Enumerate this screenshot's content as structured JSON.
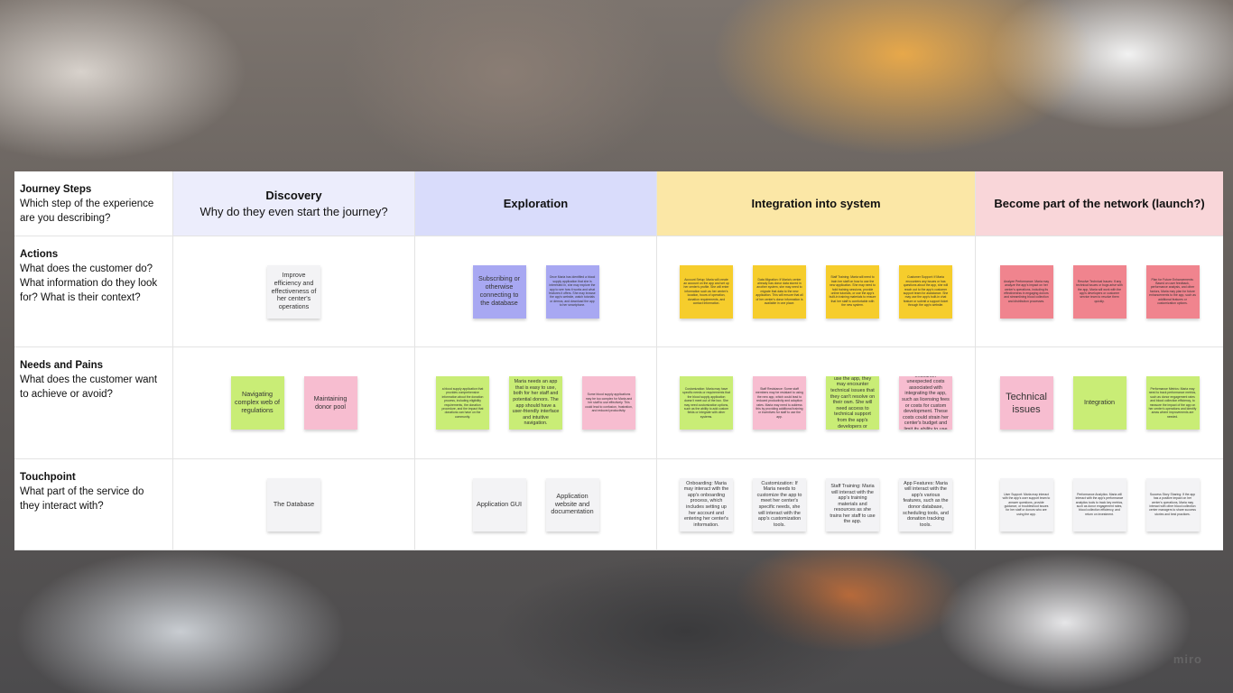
{
  "rows": [
    {
      "title": "Journey Steps",
      "desc": "Which step of the experience are you describing?"
    },
    {
      "title": "Actions",
      "desc": "What does the customer do? What information do they look for? What is their context?"
    },
    {
      "title": "Needs and Pains",
      "desc": "What does the customer want to achieve or avoid?"
    },
    {
      "title": "Touchpoint",
      "desc": "What part of the service do they interact with?"
    }
  ],
  "stages": [
    {
      "title": "Discovery",
      "subtitle": "Why do they even start the journey?",
      "color": "#ecedfc"
    },
    {
      "title": "Exploration",
      "subtitle": "",
      "color": "#d9dcfb"
    },
    {
      "title": "Integration into system",
      "subtitle": "",
      "color": "#fbe7a6"
    },
    {
      "title": "Become part of the network (launch?)",
      "subtitle": "",
      "color": "#f9d6d9"
    }
  ],
  "notes": {
    "actions": [
      [
        {
          "text": "Improve efficiency and effectiveness of her center's operations",
          "color": "white",
          "size": "big"
        }
      ],
      [
        {
          "text": "Subscribing or otherwise connecting to the database",
          "color": "blue",
          "size": "big"
        },
        {
          "text": "Once Maria has identified a blood supply application that she is interested in, she may explore the app to see how it works and what features it offers. She may browse the app's website, watch tutorials or demos, and download the app to her smartphone.",
          "color": "blue",
          "size": "small"
        }
      ],
      [
        {
          "text": "Account Setup: Maria will create an account on the app and set up her center's profile. She will enter information such as her center's location, hours of operation, donation requirements, and contact information.",
          "color": "yellow",
          "size": "small"
        },
        {
          "text": "Data Migration: If Maria's center already has donor data stored in another system, she may need to migrate that data to the new application. This will ensure that all of her center's donor information is available in one place.",
          "color": "yellow",
          "size": "small"
        },
        {
          "text": "Staff Training: Maria will need to train her staff on how to use the new application. She may need to hold training sessions, provide online tutorials, or use the app's built-in training materials to ensure that her staff is comfortable with the new system.",
          "color": "yellow",
          "size": "small"
        },
        {
          "text": "Customer Support: If Maria encounters any issues or has questions about the app, she will reach out to the app's customer support team for assistance. She may use the app's built-in chat feature or submit a support ticket through the app's website.",
          "color": "yellow",
          "size": "small"
        }
      ],
      [
        {
          "text": "Analyze Performance: Maria may analyze the app's impact on her center's operations, including its effectiveness in engaging donors and streamlining blood collection and distribution processes.",
          "color": "red",
          "size": "small"
        },
        {
          "text": "Resolve Technical Issues: If any technical issues or bugs arise with the app, Maria will work with the app's developers or customer service team to resolve them quickly.",
          "color": "red",
          "size": "small"
        },
        {
          "text": "Plan for Future Enhancements: Based on user feedback, performance analysis, and other factors, Maria may plan for future enhancements to the app, such as additional features or customization options.",
          "color": "red",
          "size": "small"
        }
      ]
    ],
    "needs": [
      [
        {
          "text": "Navigating complex web of regulations",
          "color": "green",
          "size": "big"
        },
        {
          "text": "Maintaining donor pool",
          "color": "pink",
          "size": "big"
        }
      ],
      [
        {
          "text": "a blood supply application that provides comprehensive information about the donation process, including eligibility requirements, the donation procedure, and the impact that donations can have on the community.",
          "color": "green",
          "size": "small"
        },
        {
          "text": "Maria needs an app that is easy to use, both for her staff and potential donors. The app should have a user-friendly interface and intuitive navigation.",
          "color": "green",
          "size": "mid"
        },
        {
          "text": "Some blood supply applications may be too complex for Maria and her staff to use effectively. This could lead to confusion, frustration, and reduced productivity.",
          "color": "pink",
          "size": "small"
        }
      ],
      [
        {
          "text": "Customization: Maria may have specific needs or requirements that the blood supply application doesn't meet out of the box. She may need customization options, such as the ability to add custom fields or integrate with other systems.",
          "color": "green",
          "size": "small"
        },
        {
          "text": "Staff Resistance: Some staff members may be resistant to using the new app, which could lead to reduced productivity and adoption rates. Maria may need to address this by providing additional training or incentives for staff to use the app.",
          "color": "pink",
          "size": "small"
        },
        {
          "text": "Technical Support: As Maria and her staff use the app, they may encounter technical issues that they can't resolve on their own. She will need access to technical support from the app's developers or customer service team.",
          "color": "green",
          "size": "mid"
        },
        {
          "text": "Cost: Maria may encounter unexpected costs associated with integrating the app, such as licensing fees or costs for custom development. These costs could strain her center's budget and limit its ability to use the app effectively.",
          "color": "pink",
          "size": "mid"
        }
      ],
      [
        {
          "text": "Technical issues",
          "color": "pink",
          "size": "huge"
        },
        {
          "text": "Integration",
          "color": "green",
          "size": "big"
        },
        {
          "text": "Performance Metrics: Maria may need to track performance metrics, such as donor engagement rates and blood collection efficiency, to measure the impact of the app on her center's operations and identify areas where improvements are needed.",
          "color": "green",
          "size": "small"
        }
      ]
    ],
    "touchpoints": [
      [
        {
          "text": "The Database",
          "color": "white",
          "size": "big"
        }
      ],
      [
        {
          "text": "Application GUI",
          "color": "white",
          "size": "big"
        },
        {
          "text": "Application website and documentation",
          "color": "white",
          "size": "big"
        }
      ],
      [
        {
          "text": "Onboarding: Maria may interact with the app's onboarding process, which includes setting up her account and entering her center's information.",
          "color": "white",
          "size": "mid"
        },
        {
          "text": "Customization: If Maria needs to customize the app to meet her center's specific needs, she will interact with the app's customization tools.",
          "color": "white",
          "size": "mid"
        },
        {
          "text": "Staff Training: Maria will interact with the app's training materials and resources as she trains her staff to use the app.",
          "color": "white",
          "size": "mid"
        },
        {
          "text": "App Features: Maria will interact with the app's various features, such as the donor database, scheduling tools, and donation tracking tools.",
          "color": "white",
          "size": "mid"
        }
      ],
      [
        {
          "text": "User Support: Maria may interact with the app's user support team to answer questions, provide guidance, or troubleshoot issues for her staff or donors who are using the app.",
          "color": "white",
          "size": "small"
        },
        {
          "text": "Performance Analytics: Maria will interact with the app's performance analytics tools to track key metrics, such as donor engagement rates, blood collection efficiency, and return on investment.",
          "color": "white",
          "size": "small"
        },
        {
          "text": "Success Story Sharing: If the app has a positive impact on her center's operations, Maria may interact with other blood collection center managers to share success stories and best practices.",
          "color": "white",
          "size": "small"
        }
      ]
    ]
  },
  "watermark": "miro"
}
